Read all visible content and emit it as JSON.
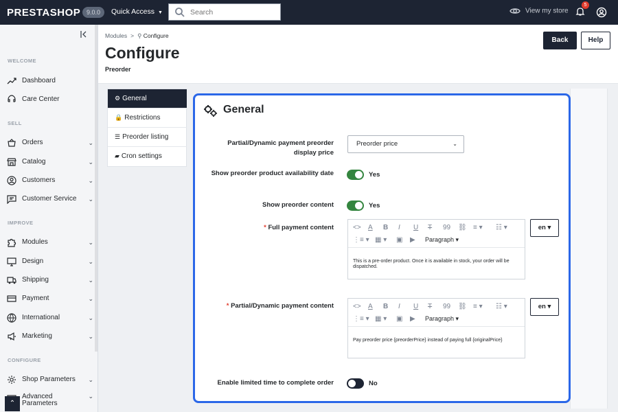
{
  "topbar": {
    "logo": "PRESTASHOP",
    "version": "9.0.0",
    "quick_access": "Quick Access",
    "search_placeholder": "Search",
    "view_store": "View my store",
    "notification_count": "5"
  },
  "sidebar": {
    "welcome": "WELCOME",
    "sell": "SELL",
    "improve": "IMPROVE",
    "configure": "CONFIGURE",
    "items": [
      {
        "label": "Dashboard",
        "icon": "trending-up-icon"
      },
      {
        "label": "Care Center",
        "icon": "headset-icon"
      },
      {
        "label": "Orders",
        "icon": "basket-icon"
      },
      {
        "label": "Catalog",
        "icon": "store-icon"
      },
      {
        "label": "Customers",
        "icon": "account-circle-icon"
      },
      {
        "label": "Customer Service",
        "icon": "chat-icon"
      },
      {
        "label": "Modules",
        "icon": "puzzle-icon"
      },
      {
        "label": "Design",
        "icon": "desktop-icon"
      },
      {
        "label": "Shipping",
        "icon": "truck-icon"
      },
      {
        "label": "Payment",
        "icon": "credit-card-icon"
      },
      {
        "label": "International",
        "icon": "globe-icon"
      },
      {
        "label": "Marketing",
        "icon": "campaign-icon"
      },
      {
        "label": "Shop Parameters",
        "icon": "settings-icon"
      },
      {
        "label": "Advanced Parameters",
        "icon": "settings-applications-icon"
      }
    ]
  },
  "header": {
    "breadcrumb_modules": "Modules",
    "breadcrumb_configure": "Configure",
    "title": "Configure",
    "subtitle": "Preorder",
    "back": "Back",
    "help": "Help"
  },
  "tabs": [
    {
      "label": "General",
      "icon": "cogs-icon"
    },
    {
      "label": "Restrictions",
      "icon": "lock-icon"
    },
    {
      "label": "Preorder listing",
      "icon": "list-icon"
    },
    {
      "label": "Cron settings",
      "icon": "book-icon"
    }
  ],
  "panel": {
    "title": "General",
    "display_price_label": "Partial/Dynamic payment preorder display price",
    "display_price_value": "Preorder price",
    "show_availability_label": "Show preorder product availability date",
    "show_availability_value": "Yes",
    "show_content_label": "Show preorder content",
    "show_content_value": "Yes",
    "full_payment_label": "Full payment content",
    "full_payment_text": "This is a pre-order product. Once it is available in stock, your order will be dispatched.",
    "partial_payment_label": "Partial/Dynamic payment content",
    "partial_payment_text": "Pay preorder price {preorderPrice} instead of paying full {originalPrice}",
    "paragraph": "Paragraph",
    "language": "en",
    "limited_time_label": "Enable limited time to complete order",
    "limited_time_value": "No"
  }
}
